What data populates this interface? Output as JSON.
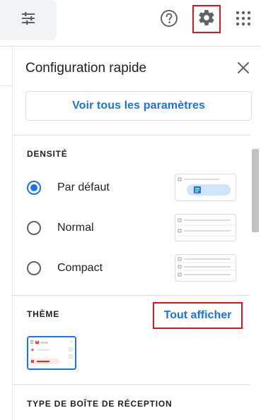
{
  "panel": {
    "title": "Configuration rapide",
    "settings_button": "Voir tous les paramètres"
  },
  "density": {
    "label": "DENSITÉ",
    "options": [
      {
        "label": "Par défaut",
        "checked": true
      },
      {
        "label": "Normal",
        "checked": false
      },
      {
        "label": "Compact",
        "checked": false
      }
    ]
  },
  "theme": {
    "label": "THÈME",
    "show_all": "Tout afficher",
    "thumbnail_text": "Gmail"
  },
  "inbox_type": {
    "label": "TYPE DE BOÎTE DE RÉCEPTION"
  },
  "icons": {
    "filter": "tune-icon",
    "help": "help-icon",
    "settings": "gear-icon",
    "apps": "apps-grid-icon",
    "close": "close-icon"
  },
  "colors": {
    "accent": "#1a73e8",
    "highlight_box": "#e0141e"
  }
}
